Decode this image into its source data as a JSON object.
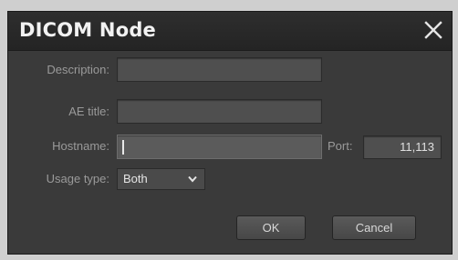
{
  "dialog": {
    "title": "DICOM Node",
    "close_icon": "close-icon"
  },
  "form": {
    "description_label": "Description:",
    "description_value": "",
    "ae_title_label": "AE title:",
    "ae_title_value": "",
    "hostname_label": "Hostname:",
    "hostname_value": "",
    "port_label": "Port:",
    "port_value": "11,113",
    "usage_type_label": "Usage type:",
    "usage_type_value": "Both"
  },
  "buttons": {
    "ok_label": "OK",
    "cancel_label": "Cancel"
  }
}
